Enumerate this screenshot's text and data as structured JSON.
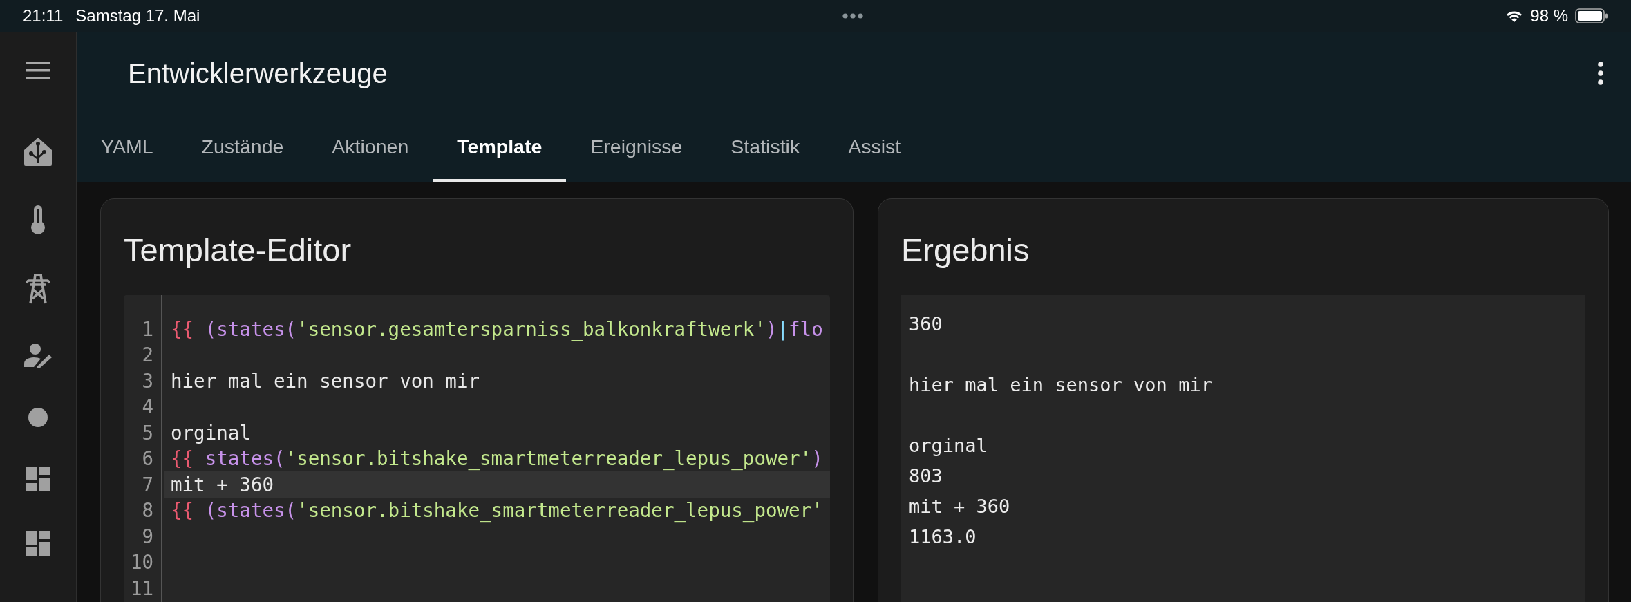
{
  "status_bar": {
    "time": "21:11",
    "date": "Samstag 17. Mai",
    "battery": "98 %"
  },
  "header": {
    "title": "Entwicklerwerkzeuge"
  },
  "tabs": [
    {
      "label": "YAML",
      "selected": false
    },
    {
      "label": "Zustände",
      "selected": false
    },
    {
      "label": "Aktionen",
      "selected": false
    },
    {
      "label": "Template",
      "selected": true
    },
    {
      "label": "Ereignisse",
      "selected": false
    },
    {
      "label": "Statistik",
      "selected": false
    },
    {
      "label": "Assist",
      "selected": false
    }
  ],
  "template_editor": {
    "title": "Template-Editor",
    "lines": [
      {
        "number": "1",
        "active": false,
        "tokens": [
          {
            "kind": "delimiter",
            "text": "{{ "
          },
          {
            "kind": "function",
            "text": "(states("
          },
          {
            "kind": "string",
            "text": "'sensor.gesamtersparniss_balkonkraftwerk'"
          },
          {
            "kind": "function",
            "text": ")"
          },
          {
            "kind": "operator",
            "text": "|"
          },
          {
            "kind": "function",
            "text": "flo"
          }
        ]
      },
      {
        "number": "2",
        "active": false
      },
      {
        "number": "3",
        "active": false,
        "tokens": [
          {
            "kind": "text",
            "text": "hier mal ein sensor von mir"
          }
        ]
      },
      {
        "number": "4",
        "active": false
      },
      {
        "number": "5",
        "active": false,
        "tokens": [
          {
            "kind": "text",
            "text": "orginal"
          }
        ]
      },
      {
        "number": "6",
        "active": false,
        "tokens": [
          {
            "kind": "delimiter",
            "text": "{{ "
          },
          {
            "kind": "function",
            "text": "states("
          },
          {
            "kind": "string",
            "text": "'sensor.bitshake_smartmeterreader_lepus_power'"
          },
          {
            "kind": "function",
            "text": ")"
          }
        ]
      },
      {
        "number": "7",
        "active": true,
        "tokens": [
          {
            "kind": "text",
            "text": "mit + 360"
          }
        ]
      },
      {
        "number": "8",
        "active": false,
        "tokens": [
          {
            "kind": "delimiter",
            "text": "{{ "
          },
          {
            "kind": "function",
            "text": "(states("
          },
          {
            "kind": "string",
            "text": "'sensor.bitshake_smartmeterreader_lepus_power'"
          }
        ]
      },
      {
        "number": "9",
        "active": false
      },
      {
        "number": "10",
        "active": false
      },
      {
        "number": "11",
        "active": false
      }
    ]
  },
  "result": {
    "title": "Ergebnis",
    "output": "360\n\nhier mal ein sensor von mir\n\norginal\n803\nmit + 360\n1163.0"
  }
}
